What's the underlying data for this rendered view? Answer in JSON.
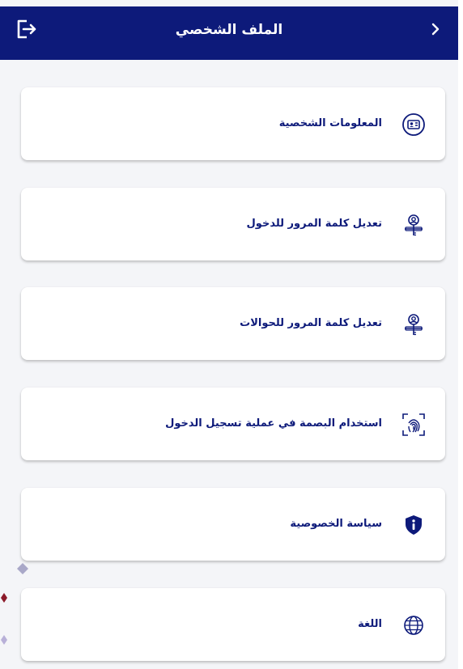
{
  "header": {
    "title": "الملف الشخصي",
    "background": "#0d1a7a"
  },
  "menu": {
    "items": [
      {
        "label": "المعلومات الشخصية",
        "icon": "id-card-icon"
      },
      {
        "label": "تعديل كلمة المرور للدخول",
        "icon": "user-key-icon"
      },
      {
        "label": "تعديل كلمة المرور للحوالات",
        "icon": "user-key-icon"
      },
      {
        "label": "استخدام البصمة في عملية تسجيل الدخول",
        "icon": "fingerprint-scan-icon"
      },
      {
        "label": "سياسة الخصوصية",
        "icon": "shield-info-icon"
      },
      {
        "label": "اللغة",
        "icon": "globe-icon"
      }
    ]
  },
  "colors": {
    "accent": "#0d1a7a",
    "card": "#ffffff",
    "page": "#f4f5f8"
  }
}
